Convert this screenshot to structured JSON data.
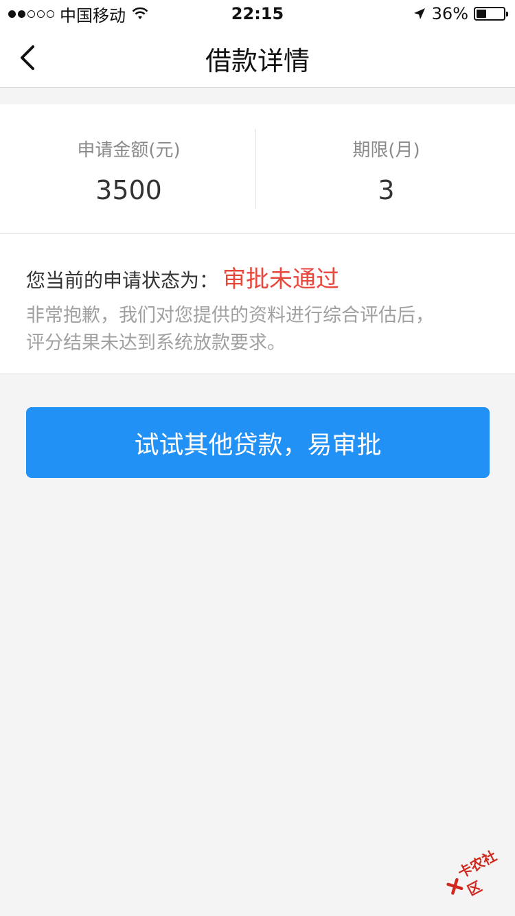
{
  "status_bar": {
    "carrier": "中国移动",
    "time": "22:15",
    "battery_percent_label": "36%",
    "battery_level": 0.36,
    "signal_bars_filled": 2,
    "signal_bars_total": 5
  },
  "nav": {
    "title": "借款详情",
    "back_icon": "chevron-left-icon"
  },
  "summary": {
    "amount_label": "申请金额(元)",
    "amount_value": "3500",
    "term_label": "期限(月)",
    "term_value": "3"
  },
  "application_status": {
    "prefix": "您当前的申请状态为：",
    "value": "审批未通过",
    "description_line1": "非常抱歉，我们对您提供的资料进行综合评估后，",
    "description_line2": "评分结果未达到系统放款要求。"
  },
  "action": {
    "label": "试试其他贷款，易审批"
  },
  "watermark": {
    "text": "卡农社区"
  },
  "colors": {
    "accent": "#2291f6",
    "error": "#e8473c"
  }
}
